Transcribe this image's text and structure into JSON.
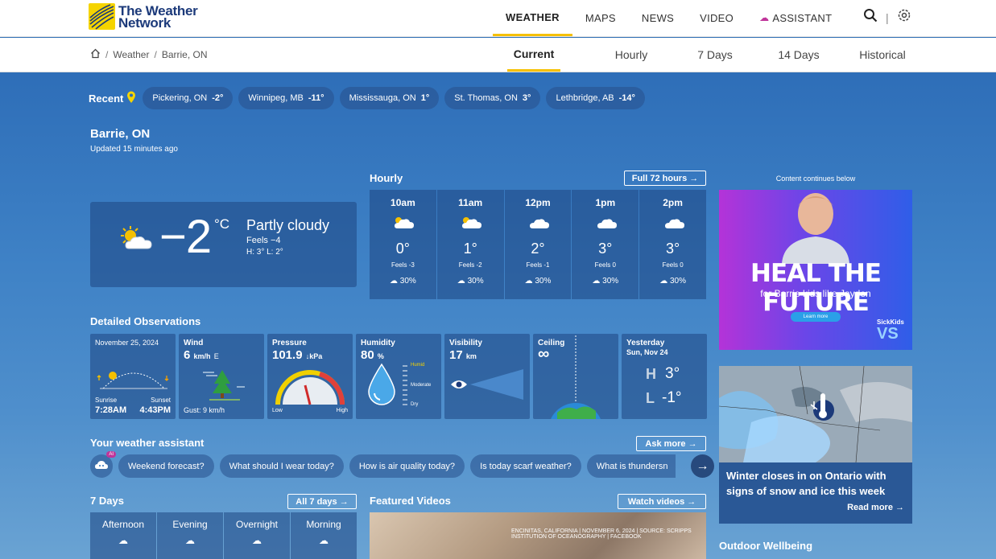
{
  "brand": {
    "line1": "The Weather",
    "line2": "Network"
  },
  "nav": {
    "weather": "WEATHER",
    "maps": "MAPS",
    "news": "NEWS",
    "video": "VIDEO",
    "assistant": "ASSISTANT"
  },
  "breadcrumb": {
    "weather": "Weather",
    "city": "Barrie, ON"
  },
  "tabs": {
    "current": "Current",
    "hourly": "Hourly",
    "days7": "7 Days",
    "days14": "14 Days",
    "historical": "Historical"
  },
  "recent": {
    "label": "Recent",
    "cities": [
      {
        "name": "Pickering, ON",
        "temp": "-2°"
      },
      {
        "name": "Winnipeg, MB",
        "temp": "-11°"
      },
      {
        "name": "Mississauga, ON",
        "temp": "1°"
      },
      {
        "name": "St. Thomas, ON",
        "temp": "3°"
      },
      {
        "name": "Lethbridge, AB",
        "temp": "-14°"
      }
    ]
  },
  "location": {
    "name": "Barrie, ON",
    "updated": "Updated 15 minutes ago"
  },
  "current": {
    "temp": "−2",
    "unit": "°C",
    "condition": "Partly cloudy",
    "feels": "Feels −4",
    "hl": "H: 3°   L: 2°"
  },
  "hourly": {
    "title": "Hourly",
    "button": "Full 72 hours →",
    "hours": [
      {
        "time": "10am",
        "temp": "0°",
        "feels": "Feels -3",
        "pop": "30%"
      },
      {
        "time": "11am",
        "temp": "1°",
        "feels": "Feels -2",
        "pop": "30%"
      },
      {
        "time": "12pm",
        "temp": "2°",
        "feels": "Feels -1",
        "pop": "30%"
      },
      {
        "time": "1pm",
        "temp": "3°",
        "feels": "Feels 0",
        "pop": "30%"
      },
      {
        "time": "2pm",
        "temp": "3°",
        "feels": "Feels 0",
        "pop": "30%"
      }
    ]
  },
  "observations": {
    "title": "Detailed Observations",
    "date": "November 25, 2024",
    "sunrise_label": "Sunrise",
    "sunrise": "7:28AM",
    "sunset_label": "Sunset",
    "sunset": "4:43PM",
    "wind_label": "Wind",
    "wind": "6",
    "wind_unit": "km/h",
    "wind_dir": "E",
    "gust": "Gust: 9 km/h",
    "pressure_label": "Pressure",
    "pressure": "101.9",
    "pressure_unit": "↓kPa",
    "pressure_low": "Low",
    "pressure_high": "High",
    "humidity_label": "Humidity",
    "humidity": "80",
    "humidity_unit": "%",
    "humid": "Humid",
    "moderate": "Moderate",
    "dry": "Dry",
    "visibility_label": "Visibility",
    "visibility": "17",
    "visibility_unit": "km",
    "ceiling_label": "Ceiling",
    "ceiling": "∞",
    "yesterday_label": "Yesterday",
    "yesterday_date": "Sun, Nov 24",
    "yesterday_h_label": "H",
    "yesterday_h": "3°",
    "yesterday_l_label": "L",
    "yesterday_l": "-1°"
  },
  "assistant": {
    "title": "Your weather assistant",
    "button": "Ask more →",
    "badge": "AI",
    "prompts": [
      "Weekend forecast?",
      "What should I wear today?",
      "How is air quality today?",
      "Is today scarf weather?",
      "What is thundersn"
    ]
  },
  "seven_days": {
    "title": "7 Days",
    "button": "All 7 days →",
    "periods": [
      "Afternoon",
      "Evening",
      "Overnight",
      "Morning"
    ]
  },
  "videos": {
    "title": "Featured Videos",
    "button": "Watch videos →",
    "caption": "ENCINITAS, CALIFORNIA | NOVEMBER 6, 2024 | SOURCE: SCRIPPS INSTITUTION OF OCEANOGRAPHY | FACEBOOK"
  },
  "ad": {
    "note": "Content continues below",
    "headline": "HEAL THE FUTURE",
    "sub": "for Barrie kids like Jayden",
    "learn": "Learn more",
    "brand": "SickKids",
    "vs": "VS"
  },
  "news": {
    "title": "Winter closes in on Ontario with signs of snow and ice this week",
    "read_more": "Read more →"
  },
  "outdoor": {
    "title": "Outdoor Wellbeing"
  }
}
